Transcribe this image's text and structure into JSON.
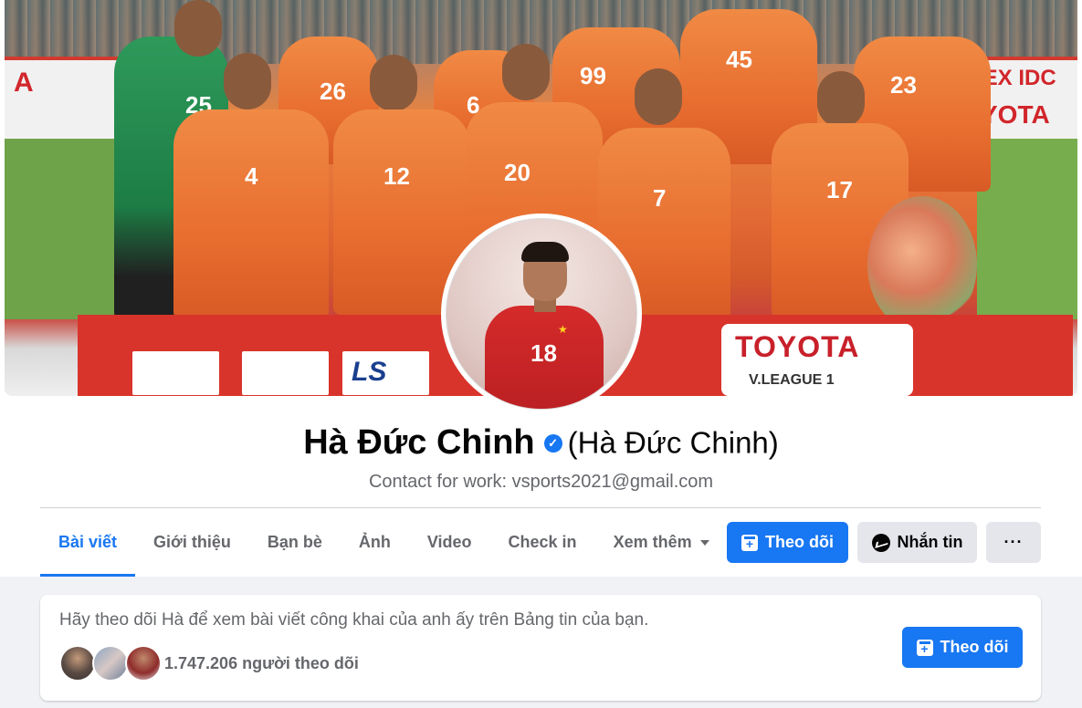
{
  "profile": {
    "name": "Hà Đức Chinh",
    "alt_name": "(Hà Đức Chinh)",
    "bio": "Contact for work: vsports2021@gmail.com",
    "verified_icon": "✓"
  },
  "cover": {
    "ad_left": "A",
    "ad_right": "IEX IDC",
    "ad_right_2": "YOTA",
    "toyota": "TOYOTA",
    "vleague": "V.LEAGUE 1",
    "jersey_numbers": [
      "25",
      "26",
      "6",
      "99",
      "45",
      "23",
      "4",
      "12",
      "20",
      "7",
      "17"
    ],
    "sponsor_ls": "LS"
  },
  "avatar": {
    "jersey_number": "18",
    "star": "★"
  },
  "tabs": [
    {
      "label": "Bài viết",
      "active": true
    },
    {
      "label": "Giới thiệu"
    },
    {
      "label": "Bạn bè"
    },
    {
      "label": "Ảnh"
    },
    {
      "label": "Video"
    },
    {
      "label": "Check in"
    },
    {
      "label": "Xem thêm"
    }
  ],
  "actions": {
    "follow_label": "Theo dõi",
    "message_label": "Nhắn tin",
    "more_label": "···"
  },
  "follow_card": {
    "text": "Hãy theo dõi Hà để xem bài viết công khai của anh ấy trên Bảng tin của bạn.",
    "followers": "1.747.206 người theo dõi",
    "button_label": "Theo dõi"
  },
  "colors": {
    "accent": "#1877f2",
    "secondary_button": "#e4e6eb",
    "muted_text": "#65676b",
    "background": "#f0f2f5"
  }
}
